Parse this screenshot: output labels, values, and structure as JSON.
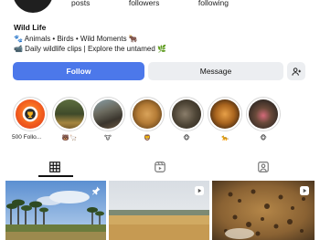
{
  "profile": {
    "stats": [
      {
        "label": "posts"
      },
      {
        "label": "followers"
      },
      {
        "label": "following"
      }
    ],
    "name": "Wild Life",
    "bio_line1": "🐾 Animals • Birds • Wild Moments 🐂",
    "bio_line2": "📹 Daily wildlife clips | Explore the untamed 🌿"
  },
  "actions": {
    "follow_label": "Follow",
    "message_label": "Message",
    "add_user_icon": "add-user-icon"
  },
  "highlights": [
    {
      "label": "500 Follo...",
      "icon": "trophy"
    },
    {
      "label": "🐻🦙",
      "icon": "animals"
    },
    {
      "label": "🐮",
      "icon": "cattle"
    },
    {
      "label": "🦁",
      "icon": "lion"
    },
    {
      "label": "🐵",
      "icon": "monkey"
    },
    {
      "label": "🐆",
      "icon": "leopard"
    },
    {
      "label": "🐵",
      "icon": "primate"
    }
  ],
  "tabs": [
    {
      "name": "grid",
      "icon": "grid-icon"
    },
    {
      "name": "reels",
      "icon": "reels-icon"
    },
    {
      "name": "tagged",
      "icon": "tagged-icon"
    }
  ],
  "colors": {
    "follow": "#4c78ea",
    "secondary_button": "#eceef1"
  }
}
